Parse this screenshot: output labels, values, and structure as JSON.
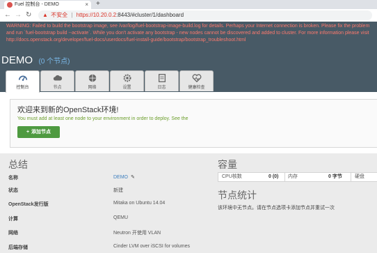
{
  "browser": {
    "tab_title": "Fuel 控制台 - DEMO",
    "tab_close": "×",
    "new_tab": "+",
    "insecure_label": "不安全",
    "url_host": "https://10.20.0.2",
    "url_rest": ":8443/#cluster/1/dashboard"
  },
  "warning": {
    "text": "WARNING: Failed to build the bootstrap image, see /var/log/fuel-bootstrap-image-build.log for details. Perhaps your Internet connection is broken. Please fix the problem and run `fuel-bootstrap build --activate`. While you don't activate any bootstrap - new nodes cannot be discovered and added to cluster. For more information please visit http://docs.openstack.org/developer/fuel-docs/userdocs/fuel-install-guide/bootstrap/bootstrap_troubleshoot.html"
  },
  "environment": {
    "name": "DEMO",
    "node_count": "(0 个节点)"
  },
  "tabs": [
    {
      "label": "控制台",
      "icon": "dashboard-icon"
    },
    {
      "label": "节点",
      "icon": "cloud-icon"
    },
    {
      "label": "网络",
      "icon": "network-icon"
    },
    {
      "label": "设置",
      "icon": "gear-icon"
    },
    {
      "label": "日志",
      "icon": "log-icon"
    },
    {
      "label": "健康检查",
      "icon": "heart-icon"
    }
  ],
  "notice": {
    "title": "欢迎来到新的OpenStack环境!",
    "subtitle": "You must add at least one node to your environment in order to deploy. See the",
    "add_button": "添加节点"
  },
  "summary": {
    "title": "总结",
    "rows": [
      {
        "key": "名称",
        "value": "DEMO"
      },
      {
        "key": "状态",
        "value": "新建"
      },
      {
        "key": "OpenStack发行版",
        "value": "Mitaka on Ubuntu 14.04"
      },
      {
        "key": "计算",
        "value": "QEMU"
      },
      {
        "key": "网络",
        "value": "Neutron 开使用 VLAN"
      },
      {
        "key": "后端存储",
        "value": "Cinder LVM over iSCSI for volumes"
      }
    ]
  },
  "capacity": {
    "title": "容量",
    "cpu_label": "CPU核数",
    "cpu_value": "0 (0)",
    "memory_label": "内存",
    "memory_value": "0 字节",
    "disk_label": "硬盘"
  },
  "node_stats": {
    "title": "节点统计",
    "message": "该环境中无节点。请在节点选项卡添加节点并重试一次"
  },
  "colors": {
    "header_bg": "#485a66",
    "warning_text": "#ff7a6e",
    "add_button": "#4e9a40",
    "link": "#3d7fbf"
  }
}
